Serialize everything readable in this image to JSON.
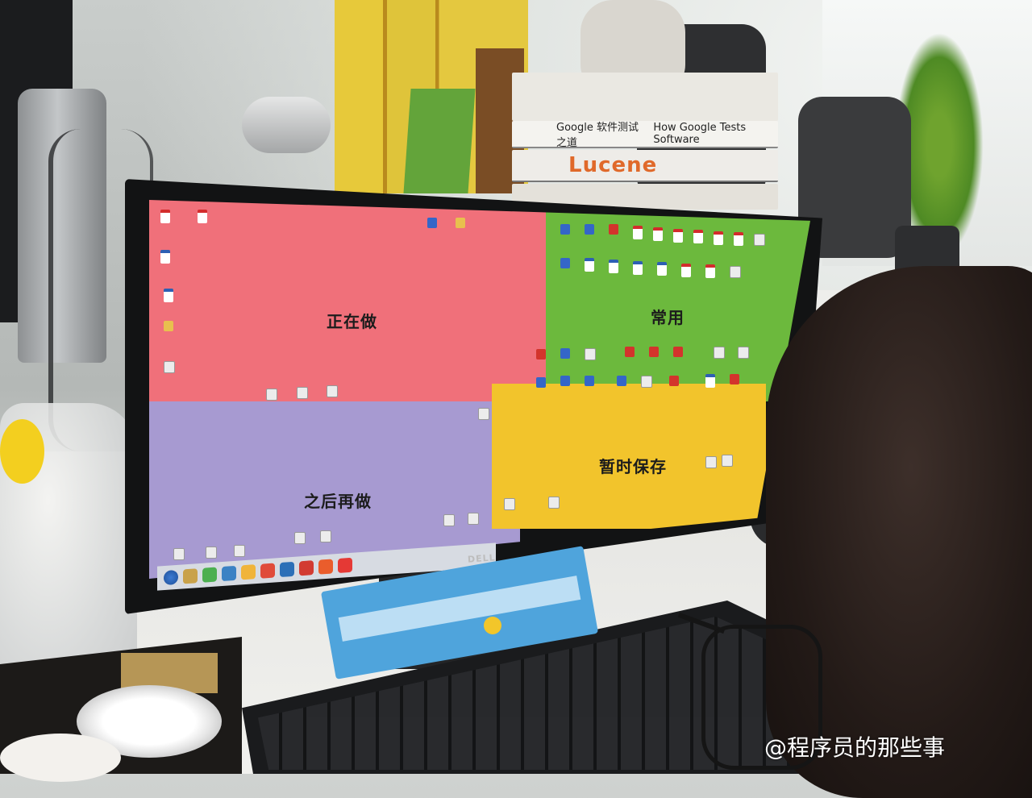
{
  "zones": {
    "doing": "正在做",
    "common": "常用",
    "later": "之后再做",
    "hold": "暂时保存"
  },
  "books": {
    "google_title": "Google 软件测试之道",
    "google_subtitle": "How Google Tests Software",
    "lucene_title": "Lucene"
  },
  "monitor": {
    "brand": "DELL"
  },
  "watermark": "@程序员的那些事",
  "colors": {
    "doing": "#f0707a",
    "common": "#6cb93d",
    "later": "#a79ad1",
    "hold": "#f2c42c"
  }
}
